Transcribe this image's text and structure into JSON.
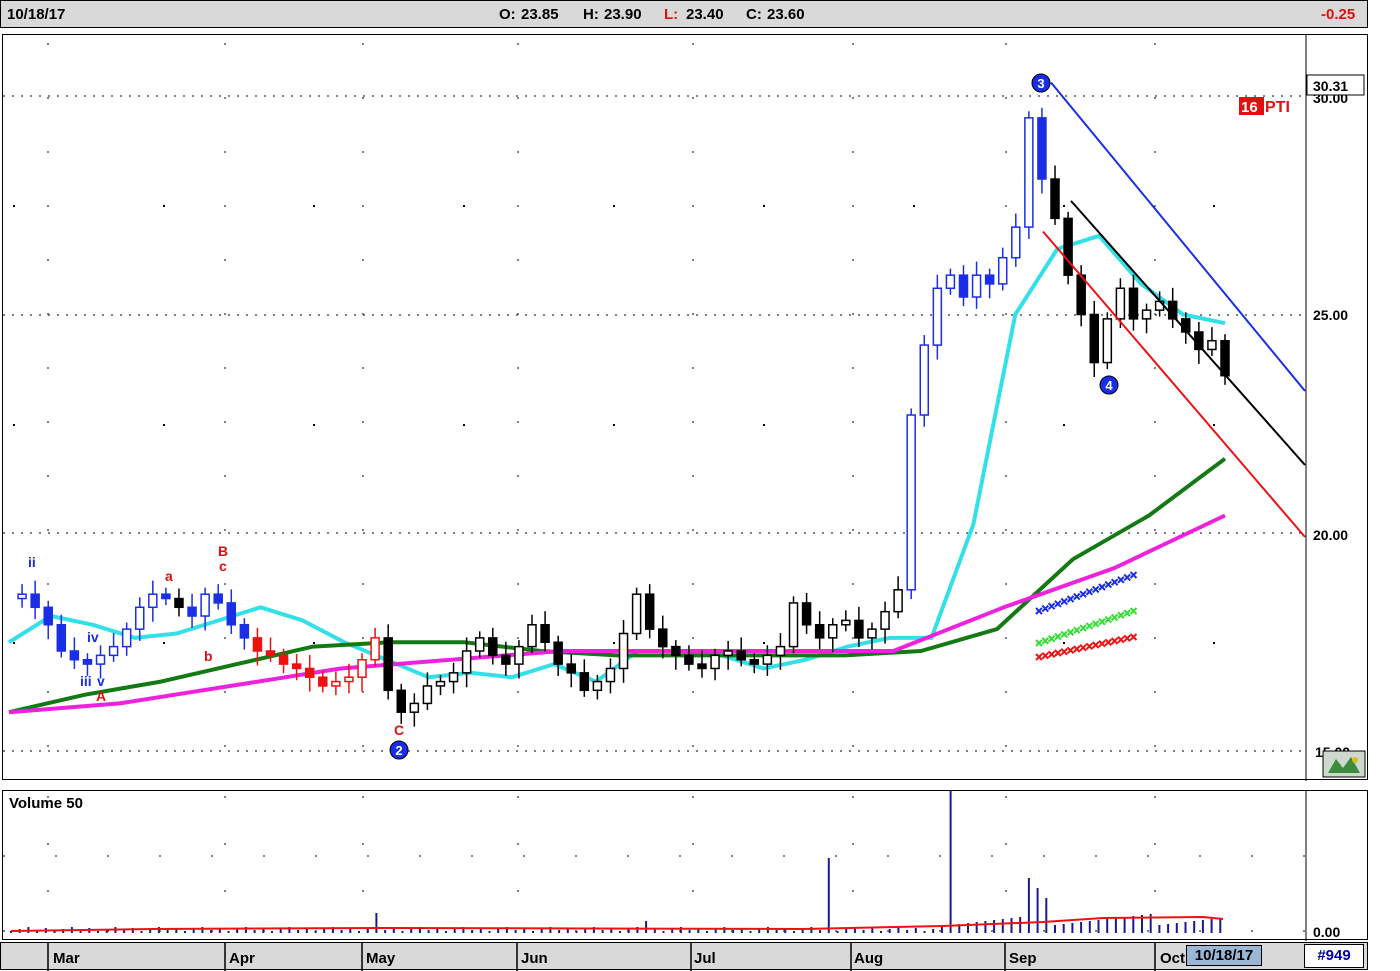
{
  "header": {
    "date": "10/18/17",
    "open_label": "O:",
    "open": "23.85",
    "high_label": "H:",
    "high": "23.90",
    "low_label": "L:",
    "low": "23.40",
    "close_label": "C:",
    "close": "23.60",
    "change": "-0.25"
  },
  "footer": {
    "months": [
      "Mar",
      "Apr",
      "May",
      "Jun",
      "Jul",
      "Aug",
      "Sep",
      "Oct"
    ],
    "current_date": "10/18/17",
    "symbol_count": "#949"
  },
  "price_panel": {
    "last_price_label": "30.31",
    "axis_ticks": [
      "30.00",
      "25.00",
      "20.00",
      "15.00"
    ],
    "badge_number": "16",
    "badge_text": "PTI",
    "wave_labels": {
      "w1": "ii",
      "w2": "iv",
      "w3": "iii",
      "w4": "v",
      "w5": "A",
      "w6": "a",
      "w7": "B",
      "w8": "c",
      "w9": "b",
      "w10": "C"
    },
    "wave_circles": {
      "c2": "2",
      "c3": "3",
      "c4": "4"
    }
  },
  "volume_panel": {
    "title": "Volume 50",
    "axis_tick": "0.00"
  },
  "colors": {
    "up_candle": "#1a2ee6",
    "down_candle": "#000000",
    "red_candle": "#ee1111",
    "ma_cyan": "#33e0e8",
    "ma_green": "#137a13",
    "ma_magenta": "#ee22dd",
    "channel_blue": "#1a2ee6",
    "channel_black": "#000000",
    "channel_red": "#ee1111",
    "volume_bar": "#1a1a8c",
    "volume_ma": "#ee1111"
  },
  "chart_data": {
    "type": "candlestick",
    "y_range": [
      15,
      31.5
    ],
    "x_months": [
      "Mar",
      "Apr",
      "May",
      "Jun",
      "Jul",
      "Aug",
      "Sep",
      "Oct"
    ],
    "ohlc_summary": {
      "date": "10/18/17",
      "open": 23.85,
      "high": 23.9,
      "low": 23.4,
      "close": 23.6,
      "change": -0.25
    },
    "price_path": [
      18.5,
      18.6,
      18.3,
      17.9,
      17.3,
      17.1,
      17.0,
      17.2,
      17.4,
      17.8,
      18.3,
      18.6,
      18.5,
      18.3,
      18.1,
      18.6,
      18.4,
      17.9,
      17.6,
      17.3,
      17.2,
      17.0,
      16.9,
      16.7,
      16.5,
      16.6,
      16.7,
      17.1,
      17.6,
      16.4,
      15.9,
      16.1,
      16.5,
      16.6,
      16.8,
      17.3,
      17.6,
      17.2,
      17.0,
      17.4,
      17.9,
      17.5,
      17.0,
      16.8,
      16.4,
      16.6,
      16.9,
      17.7,
      18.6,
      17.8,
      17.4,
      17.2,
      17.0,
      16.9,
      17.2,
      17.3,
      17.1,
      17.0,
      17.2,
      17.4,
      18.4,
      17.9,
      17.6,
      17.9,
      18.0,
      17.6,
      17.8,
      18.2,
      18.7,
      22.7,
      24.3,
      25.6,
      25.9,
      25.4,
      25.9,
      25.7,
      26.3,
      27.0,
      29.5,
      28.1,
      27.2,
      25.9,
      25.0,
      23.9,
      24.9,
      25.6,
      24.9,
      25.1,
      25.3,
      24.9,
      24.6,
      24.2,
      24.4,
      23.6
    ],
    "moving_averages": [
      {
        "color": "cyan",
        "values": [
          17.5,
          18.1,
          17.9,
          17.6,
          17.7,
          18.0,
          18.3,
          18.0,
          17.5,
          17.1,
          16.7,
          16.8,
          16.7,
          17.0,
          16.6,
          17.3,
          17.3,
          17.2,
          16.9,
          17.1,
          17.4,
          17.6,
          17.6,
          20.2,
          25.0,
          26.5,
          26.8,
          25.7,
          25.0,
          24.8
        ]
      },
      {
        "color": "green",
        "values": [
          15.9,
          16.3,
          16.6,
          17.0,
          17.4,
          17.5,
          17.5,
          17.3,
          17.2,
          17.2,
          17.2,
          17.2,
          17.3,
          17.8,
          19.4,
          20.4,
          21.7
        ]
      },
      {
        "color": "magenta",
        "values": [
          15.9,
          16.1,
          16.5,
          16.9,
          17.1,
          17.3,
          17.3,
          17.3,
          17.3,
          18.3,
          19.2,
          20.4
        ]
      }
    ],
    "channel": {
      "anchor_high": 30.31,
      "lines": [
        "blue",
        "black",
        "red"
      ]
    },
    "volume": {
      "axis": "0.00",
      "spikes": [
        0.1,
        0.2,
        0.5,
        1.0,
        0.3,
        0.2,
        0.1
      ]
    }
  }
}
